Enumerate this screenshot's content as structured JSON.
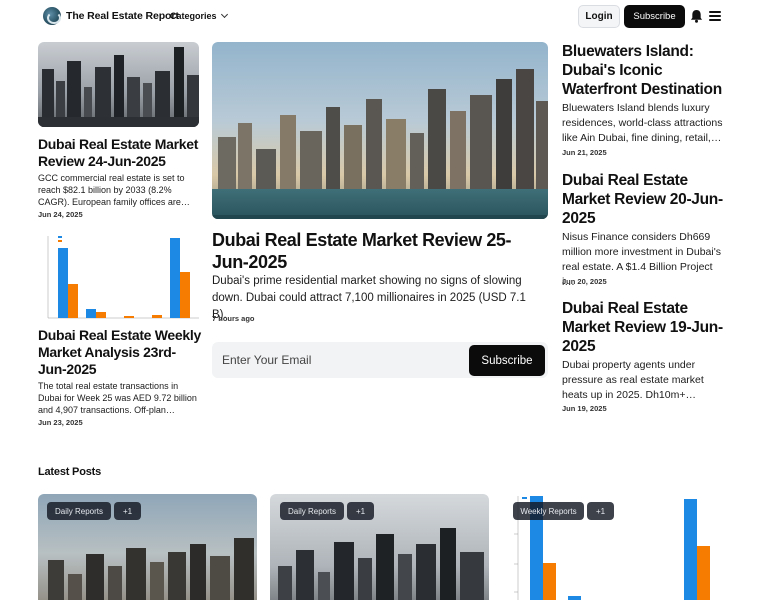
{
  "header": {
    "brand": "The Real Estate Report",
    "categories_label": "Categories",
    "login_label": "Login",
    "subscribe_label": "Subscribe",
    "icons": [
      "globe-logo-icon",
      "chevron-down-icon",
      "bell-icon",
      "menu-icon"
    ]
  },
  "left_column": [
    {
      "title": "Dubai Real Estate Market Review 24-Jun-2025",
      "excerpt": "GCC commercial real estate is set to reach $82.1 billion by 2033 (8.2% CAGR). European family offices are…",
      "date": "Jun 24, 2025"
    },
    {
      "title": "Dubai Real Estate Weekly Market Analysis 23rd-Jun-2025",
      "excerpt": "The total real estate transactions in Dubai for Week 25 was AED 9.72 billion and 4,907 transactions. Off-plan…",
      "date": "Jun 23, 2025"
    }
  ],
  "featured": {
    "title": "Dubai Real Estate Market Review 25-Jun-2025",
    "excerpt": "Dubai's prime residential market showing no signs of slowing down. Dubai could attract 7,100 millionaires in 2025 (USD 7.1 B).",
    "date": "7 hours ago"
  },
  "newsletter": {
    "placeholder": "Enter Your Email",
    "button_label": "Subscribe"
  },
  "right_column": [
    {
      "title": "Bluewaters Island: Dubai's Iconic Waterfront Destination",
      "excerpt": "Bluewaters Island blends luxury residences, world-class attractions like Ain Dubai, fine dining, retail,…",
      "date": "Jun 21, 2025"
    },
    {
      "title": "Dubai Real Estate Market Review 20-Jun-2025",
      "excerpt": "Nisus Finance considers Dh669 million more investment in Dubai's real estate. A $1.4 Billion Project i…",
      "date": "Jun 20, 2025"
    },
    {
      "title": "Dubai Real Estate Market Review 19-Jun-2025",
      "excerpt": "Dubai property agents under pressure as real estate market heats up in 2025. Dh10m+…",
      "date": "Jun 19, 2025"
    }
  ],
  "latest": {
    "section_title": "Latest Posts",
    "cards": [
      {
        "category": "Daily Reports",
        "more": "+1"
      },
      {
        "category": "Daily Reports",
        "more": "+1"
      },
      {
        "category": "Weekly Reports",
        "more": "+1"
      }
    ]
  },
  "colors": {
    "primary_button": "#0b0b0b",
    "chart_blue": "#1e88e5",
    "chart_orange": "#f57c00"
  }
}
